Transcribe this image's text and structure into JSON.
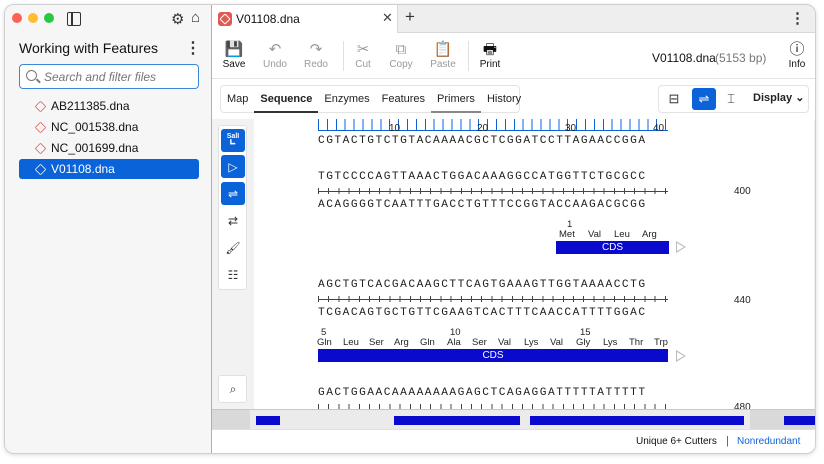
{
  "sidebar": {
    "title": "Working with Features",
    "search_placeholder": "Search and filter files",
    "files": [
      "AB211385.dna",
      "NC_001538.dna",
      "NC_001699.dna",
      "V01108.dna"
    ]
  },
  "tabs": {
    "active_tab": "V01108.dna"
  },
  "toolbar": {
    "save": "Save",
    "undo": "Undo",
    "redo": "Redo",
    "cut": "Cut",
    "copy": "Copy",
    "paste": "Paste",
    "print": "Print",
    "info": "Info",
    "doc_name": "V01108.dna",
    "doc_size": "(5153 bp)"
  },
  "view_tabs": [
    "Map",
    "Sequence",
    "Enzymes",
    "Features",
    "Primers",
    "History"
  ],
  "display_label": "Display",
  "sequence": {
    "ruler_numbers": [
      "10",
      "20",
      "30",
      "40"
    ],
    "top_line": "CGTACTGTCTGTACAAAACGCTCGGATCCTTAGAACCGGA",
    "block1_top": "TGTCCCCAGTTAAACTGGACAAAGGCCATGGTTCTGCGCC",
    "block1_bottom": "ACAGGGGTCAATTTGACCTGTTTCCGGTACCAAGACGCGG",
    "block1_pos": "400",
    "block1_aa_index": "1",
    "block1_aa": [
      "Met",
      "Val",
      "Leu",
      "Arg"
    ],
    "cds_label": "CDS",
    "block2_top": "AGCTGTCACGACAAGCTTCAGTGAAAGTTGGTAAAACCTG",
    "block2_bottom": "TCGACAGTGCTGTTCGAAGTCACTTTCAACCATTTTGGAC",
    "block2_pos": "440",
    "block2_aa_index_a": "5",
    "block2_aa_index_b": "10",
    "block2_aa_index_c": "15",
    "block2_aa": [
      "Gln",
      "Leu",
      "Ser",
      "Arg",
      "Gln",
      "Ala",
      "Ser",
      "Val",
      "Lys",
      "Val",
      "Gly",
      "Lys",
      "Thr",
      "Trp"
    ],
    "block3_top": "GACTGGAACAAAAAAAAGAGCTCAGAGGATTTTTATTTTT",
    "block3_pos": "480"
  },
  "status": {
    "cutters": "Unique 6+ Cutters",
    "separator": "|",
    "mode": "Nonredundant"
  },
  "colors": {
    "accent": "#0b63d9",
    "feature": "#0a0acf",
    "file_icon": "#e05a52"
  }
}
